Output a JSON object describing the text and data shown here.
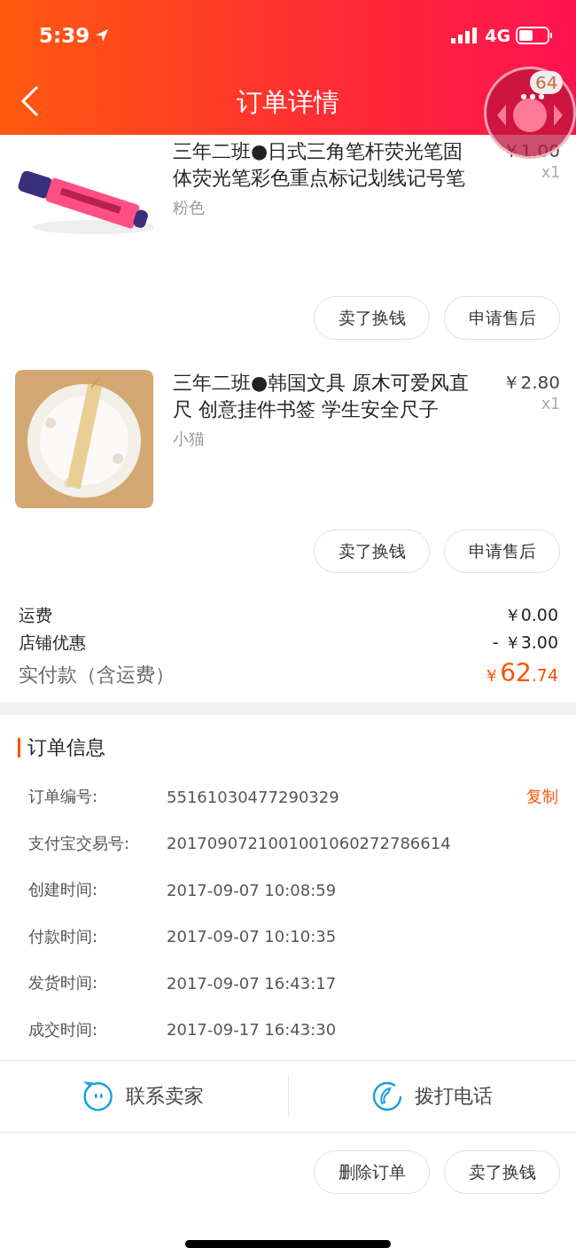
{
  "status_bar": {
    "time": "5:39",
    "network": "4G"
  },
  "nav": {
    "title": "订单详情"
  },
  "floating_button": {
    "badge": "64"
  },
  "products": [
    {
      "title": "三年二班●日式三角笔杆荧光笔固体荧光笔彩色重点标记划线记号笔",
      "variant": "粉色",
      "price": "￥1.00",
      "quantity": "x1",
      "buttons": [
        "卖了换钱",
        "申请售后"
      ]
    },
    {
      "title": "三年二班●韩国文具 原木可爱风直尺 创意挂件书签 学生安全尺子",
      "variant": "小猫",
      "price": "￥2.80",
      "quantity": "x1",
      "buttons": [
        "卖了换钱",
        "申请售后"
      ]
    }
  ],
  "summary": {
    "rows": [
      {
        "label": "运费",
        "value": "￥0.00"
      },
      {
        "label": "店铺优惠",
        "value": "- ￥3.00"
      }
    ],
    "total_label": "实付款（含运费）",
    "total": "￥62.74"
  },
  "order_info": {
    "title": "订单信息",
    "rows": [
      {
        "label": "订单编号:",
        "value": "55161030477290329",
        "action": "复制"
      },
      {
        "label": "支付宝交易号:",
        "value": "2017090721001001060272786614"
      },
      {
        "label": "创建时间:",
        "value": "2017-09-07 10:08:59"
      },
      {
        "label": "付款时间:",
        "value": "2017-09-07 10:10:35"
      },
      {
        "label": "发货时间:",
        "value": "2017-09-07 16:43:17"
      },
      {
        "label": "成交时间:",
        "value": "2017-09-17 16:43:30"
      }
    ]
  },
  "contact": [
    {
      "kind": "chat",
      "label": "联系卖家"
    },
    {
      "kind": "phone",
      "label": "拨打电话"
    }
  ],
  "actions": [
    "删除订单",
    "卖了换钱"
  ]
}
